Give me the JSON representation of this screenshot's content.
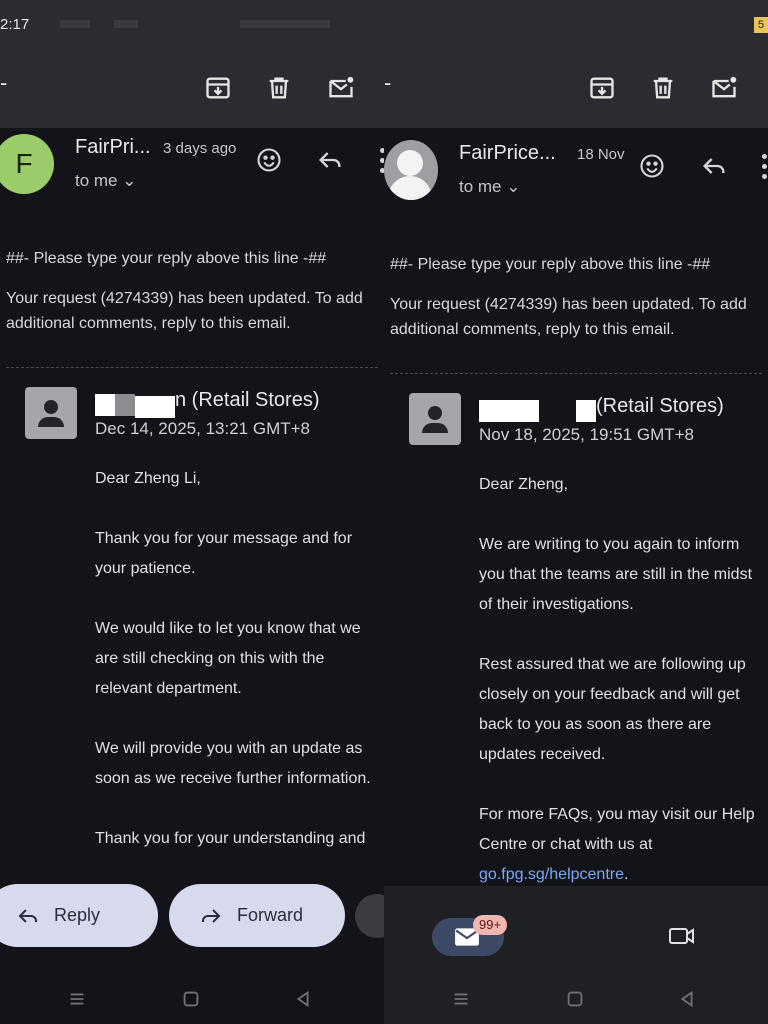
{
  "left": {
    "status": {
      "time": "2:17"
    },
    "toolbar": {
      "back": "-"
    },
    "header": {
      "avatar_letter": "F",
      "sender": "FairPri...",
      "when": "3 days ago",
      "to": "to me"
    },
    "intro": {
      "line": "##- Please type your reply above this line -##",
      "update": "Your request (4274339) has been updated. To add additional comments, reply to this email."
    },
    "agent": {
      "name_suffix": "n (Retail Stores)",
      "date": "Dec 14, 2025, 13:21 GMT+8"
    },
    "message": [
      "Dear Zheng Li,",
      "Thank you for your message and for your patience.",
      "We would like to let you know that we are still checking on this with the relevant department.",
      "We will provide you with an update as soon as we receive further information.",
      "Thank you for your understanding and"
    ],
    "actions": {
      "reply": "Reply",
      "forward": "Forward"
    }
  },
  "right": {
    "status": {
      "batt": "5"
    },
    "toolbar": {
      "back": "-"
    },
    "header": {
      "sender": "FairPrice...",
      "when": "18 Nov",
      "to": "to me"
    },
    "intro": {
      "line": "##- Please type your reply above this line -##",
      "update": "Your request (4274339) has been updated. To add additional comments, reply to this email."
    },
    "agent": {
      "name_suffix": "(Retail Stores)",
      "date": "Nov 18, 2025, 19:51 GMT+8"
    },
    "message": {
      "greeting": "Dear Zheng,",
      "p1": "We are writing to you again to inform you that the teams are still in the midst of their investigations.",
      "p2": "Rest assured that we are following up closely on your feedback and will get back to you as soon as there are updates received.",
      "p3_text": "For more FAQs, you may visit our Help Centre or chat with us at",
      "p3_link": "go.fpg.sg/helpcentre",
      "p3_end": "."
    },
    "bottom_nav": {
      "badge": "99+"
    }
  },
  "icons": [
    "archive-icon",
    "delete-icon",
    "mark-unread-icon",
    "emoji-icon",
    "reply-icon",
    "more-icon",
    "forward-icon",
    "mail-icon",
    "video-icon",
    "menu-icon",
    "home-icon",
    "back-nav-icon"
  ],
  "colors": {
    "avatar_green": "#9ccc6a",
    "pill": "#d7d9ec",
    "link": "#7aa7f5",
    "badge": "#f1b6b0"
  }
}
